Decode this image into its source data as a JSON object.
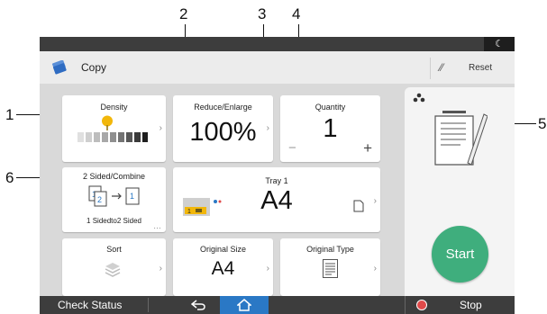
{
  "callouts": [
    "1",
    "2",
    "3",
    "4",
    "5",
    "6"
  ],
  "header": {
    "title": "Copy",
    "reset_label": "Reset"
  },
  "tiles": {
    "density": {
      "label": "Density"
    },
    "reduce": {
      "label": "Reduce/Enlarge",
      "value": "100%"
    },
    "quantity": {
      "label": "Quantity",
      "value": "1",
      "minus": "−",
      "plus": "+"
    },
    "sided": {
      "label": "2 Sided/Combine",
      "sub": "1 Sidedto2 Sided"
    },
    "tray": {
      "label": "Tray 1",
      "paper": "A4"
    },
    "sort": {
      "label": "Sort"
    },
    "original_size": {
      "label": "Original Size",
      "value": "A4"
    },
    "original_type": {
      "label": "Original Type"
    }
  },
  "start_label": "Start",
  "bottombar": {
    "check_status": "Check Status",
    "stop": "Stop"
  },
  "colors": {
    "start": "#3fae7d",
    "home": "#2a78c5",
    "stop": "#e04a4a",
    "pin": "#f2b70a"
  },
  "icons": [
    "copy-app-icon",
    "reset-icon",
    "night-mode-icon",
    "density-pin-icon",
    "back-icon",
    "home-icon",
    "stop-icon",
    "toner-icon",
    "preview-icon"
  ]
}
